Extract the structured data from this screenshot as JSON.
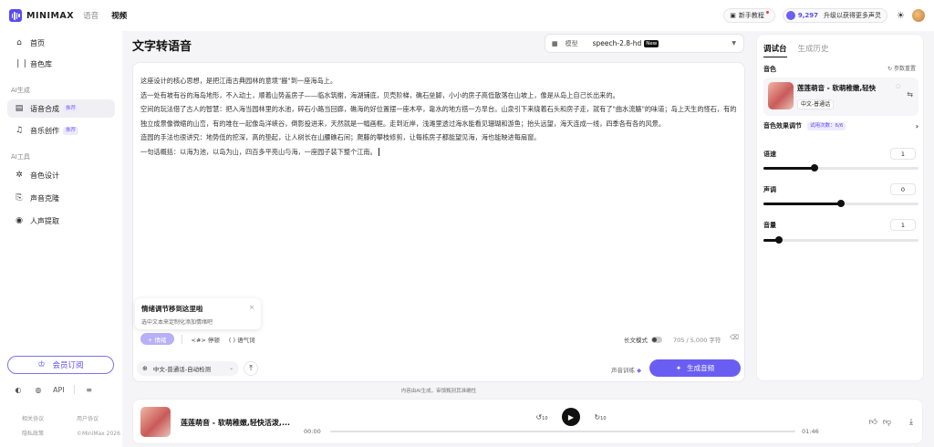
{
  "topbar": {
    "logo": "MINIMAX",
    "nav": [
      "语音",
      "视频"
    ],
    "tutorial": "新手教程",
    "credits": "9,297",
    "upgrade": "升级以获得更多声灵"
  },
  "sidebar": {
    "items": [
      {
        "label": "首页",
        "icon": "home-icon"
      },
      {
        "label": "音色库",
        "icon": "library-icon"
      }
    ],
    "group_ai": "AI生成",
    "ai_items": [
      {
        "label": "语音合成",
        "tag": "推荐"
      },
      {
        "label": "音乐创作",
        "tag": "推荐"
      }
    ],
    "group_tools": "AI工具",
    "tool_items": [
      {
        "label": "音色设计"
      },
      {
        "label": "声音克隆"
      },
      {
        "label": "人声提取"
      }
    ],
    "vip": "会员订阅",
    "icons": [
      "discord-icon",
      "wechat-icon",
      "API",
      "more-icon"
    ],
    "links": [
      "相关协议",
      "用户协议",
      "隐私政策",
      "©MiniMax 2026"
    ]
  },
  "main": {
    "title": "文字转语音",
    "model_label": "模型",
    "model_value": "speech-2.8-hd",
    "model_badge": "New",
    "paragraphs": [
      "这座设计的核心思想，是把江南古典园林的意境\"搬\"到一座海岛上。",
      "选一处有坡有谷的海岛地形，不入动土，顺着山势盖房子——临水筑榭，海湖铺底，贝壳阶梯，礁石垒脚，小小的房子高低散落在山坡上，像是从岛上自己长出来的。",
      "空间的玩法借了古人的智慧：把入海当园林里的水池，碎石小路当回廊，礁海的好位置摆一座木亭，靠水的地方搭一方旱台。山泉引下来绕着石头和房子走，就有了\"曲水流觞\"的味道；岛上天生的怪石，有的独立成景像微缩的山峦，有的堆在一起像岛洋峡谷，倒影投进来，天然就是一幅画框。走到近岸，浅滩里透过海水能看见珊瑚和游鱼；抬头远望，海天连成一线，四季各有各的风景。",
      "造园的手法也很讲究：地势低的挖深，高的垫起，让人树长在山腰礁石间；爬藤的攀枝修剪，让每栋房子都能望见海，海也能映进每扇窗。",
      "一句话概括：以海为池，以岛为山，四百多平亮山与海，一座园子装下整个江南。"
    ],
    "tooltip_title": "情绪调节移到这里啦",
    "tooltip_desc": "选中文本来定制化添加情绪吧",
    "emotion_btn": "+ 情绪",
    "pause_btn": "<#> 停顿",
    "interj_btn": "( ) 语气词",
    "longtext": "长文模式",
    "charcount": "705 / 5,000 字符",
    "lang": "中文-普通话-自动检测",
    "voice_download": "声音训练",
    "generate": "生成音频",
    "disclaimer": "内容由AI生成，审慎甄别其准确性"
  },
  "rpanel": {
    "tabs": [
      "调试台",
      "生成历史"
    ],
    "voice_label": "音色",
    "reset": "参数重置",
    "voice_name": "莲莲萌音 - 软萌稚嫩,轻快",
    "voice_tag": "中文-普通话",
    "effect": "音色效果调节",
    "effect_free": "试用次数：6/6",
    "sliders": [
      {
        "label": "语速",
        "value": "1",
        "frac": 0.33
      },
      {
        "label": "声调",
        "value": "0",
        "frac": 0.5
      },
      {
        "label": "音量",
        "value": "1",
        "frac": 0.1
      }
    ]
  },
  "player": {
    "name": "莲莲萌音 - 软萌稚嫩,轻快活泼,...",
    "current": "00:00",
    "total": "01:46",
    "skip_back": "10",
    "skip_fwd": "10"
  }
}
